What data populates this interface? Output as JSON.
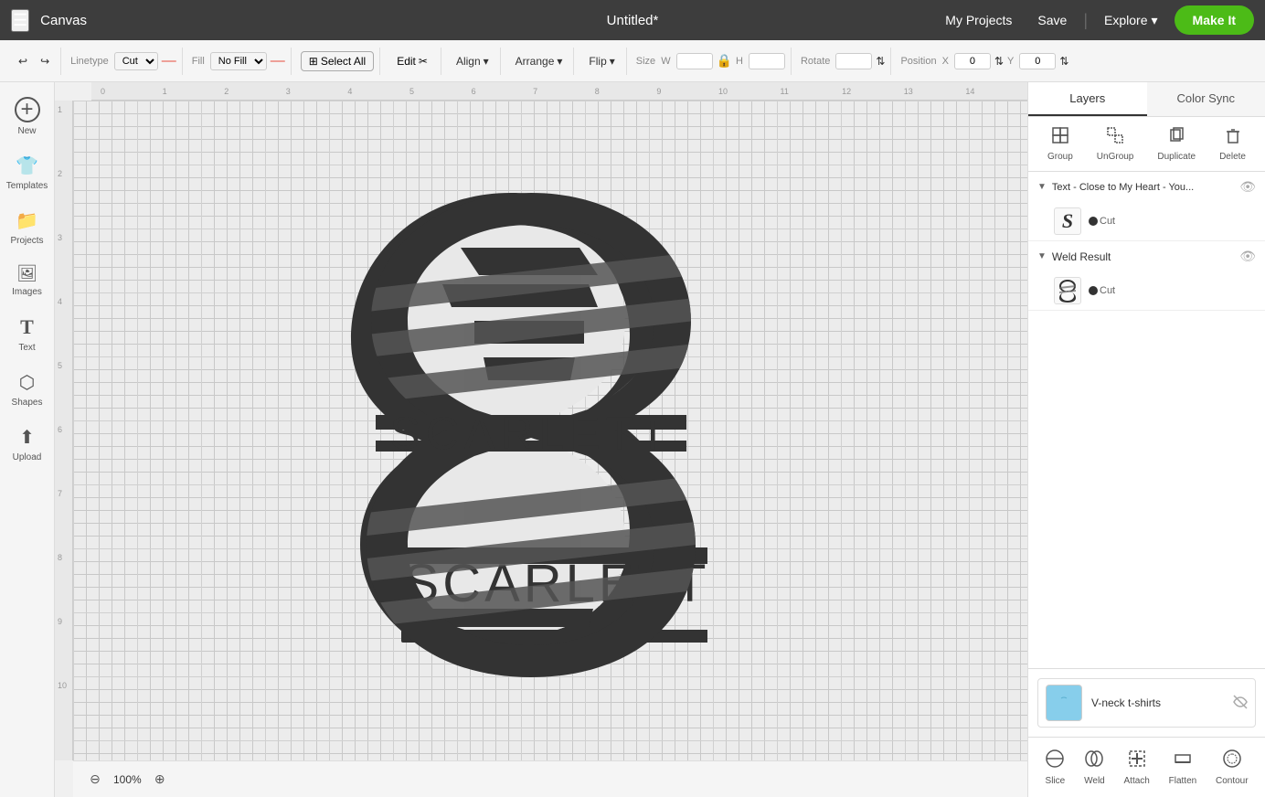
{
  "topNav": {
    "hamburger": "☰",
    "canvasLabel": "Canvas",
    "title": "Untitled*",
    "myProjectsLabel": "My Projects",
    "saveLabel": "Save",
    "exploreLabel": "Explore",
    "makeItLabel": "Make It"
  },
  "toolbar": {
    "undoIcon": "↩",
    "redoIcon": "↪",
    "linetypeLabel": "Linetype",
    "linetypeValue": "Cut",
    "fillLabel": "Fill",
    "fillValue": "No Fill",
    "selectAllLabel": "Select All",
    "editLabel": "Edit",
    "alignLabel": "Align",
    "arrangeLabel": "Arrange",
    "flipLabel": "Flip",
    "sizeLabel": "Size",
    "wLabel": "W",
    "hLabel": "H",
    "rotateLabel": "Rotate",
    "positionLabel": "Position",
    "xLabel": "X",
    "xValue": "0",
    "yLabel": "Y",
    "yValue": "0"
  },
  "leftSidebar": {
    "items": [
      {
        "icon": "+",
        "label": "New"
      },
      {
        "icon": "👕",
        "label": "Templates"
      },
      {
        "icon": "📁",
        "label": "Projects"
      },
      {
        "icon": "🖼",
        "label": "Images"
      },
      {
        "icon": "T",
        "label": "Text"
      },
      {
        "icon": "⬡",
        "label": "Shapes"
      },
      {
        "icon": "⬆",
        "label": "Upload"
      }
    ]
  },
  "canvas": {
    "zoomLevel": "100%",
    "rulerTopTicks": [
      "0",
      "1",
      "2",
      "3",
      "4",
      "5",
      "6",
      "7",
      "8",
      "9",
      "10",
      "11",
      "12",
      "13",
      "14"
    ],
    "rulerLeftTicks": [
      "1",
      "2",
      "3",
      "4",
      "5",
      "6",
      "7",
      "8",
      "9",
      "10"
    ]
  },
  "rightPanel": {
    "tabs": [
      {
        "id": "layers",
        "label": "Layers",
        "active": true
      },
      {
        "id": "colorSync",
        "label": "Color Sync",
        "active": false
      }
    ],
    "layerActions": [
      {
        "id": "group",
        "icon": "⬛",
        "label": "Group"
      },
      {
        "id": "ungroup",
        "icon": "⬜",
        "label": "UnGroup"
      },
      {
        "id": "duplicate",
        "icon": "⧉",
        "label": "Duplicate"
      },
      {
        "id": "delete",
        "icon": "🗑",
        "label": "Delete"
      }
    ],
    "layerGroups": [
      {
        "id": "text-group",
        "name": "Text - Close to My Heart - You...",
        "expanded": true,
        "visible": true,
        "items": [
          {
            "id": "s-layer",
            "type": "Cut",
            "thumbType": "s-letter"
          }
        ]
      },
      {
        "id": "weld-group",
        "name": "Weld Result",
        "expanded": true,
        "visible": true,
        "items": [
          {
            "id": "weld-layer",
            "type": "Cut",
            "thumbType": "weld-shape"
          }
        ]
      }
    ],
    "matPreview": {
      "label": "V-neck t-shirts",
      "thumbIcon": "👕"
    },
    "bottomTools": [
      {
        "id": "slice",
        "icon": "⬡",
        "label": "Slice"
      },
      {
        "id": "weld",
        "icon": "⬡",
        "label": "Weld"
      },
      {
        "id": "attach",
        "icon": "📎",
        "label": "Attach"
      },
      {
        "id": "flatten",
        "icon": "⬜",
        "label": "Flatten"
      },
      {
        "id": "contour",
        "icon": "⬡",
        "label": "Contour"
      }
    ]
  }
}
